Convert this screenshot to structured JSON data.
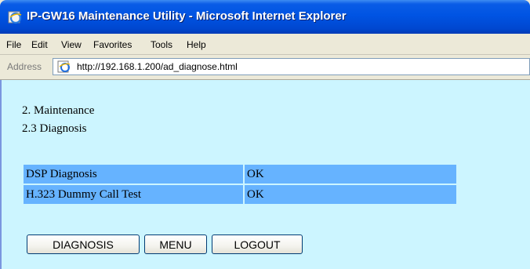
{
  "window": {
    "title": "IP-GW16 Maintenance Utility - Microsoft Internet Explorer"
  },
  "menu": {
    "items": [
      "File",
      "Edit",
      "View",
      "Favorites",
      "Tools",
      "Help"
    ]
  },
  "address": {
    "label": "Address",
    "url": "http://192.168.1.200/ad_diagnose.html"
  },
  "page": {
    "section": "2. Maintenance",
    "subsection": "2.3 Diagnosis",
    "results": [
      {
        "test": "DSP Diagnosis",
        "status": "OK"
      },
      {
        "test": "H.323 Dummy Call Test",
        "status": "OK"
      }
    ],
    "buttons": {
      "diagnosis": "DIAGNOSIS",
      "menu": "MENU",
      "logout": "LOGOUT"
    }
  },
  "colors": {
    "content_bg": "#ccf5ff",
    "table_cell": "#66b3ff",
    "titlebar": "#0054e3"
  }
}
